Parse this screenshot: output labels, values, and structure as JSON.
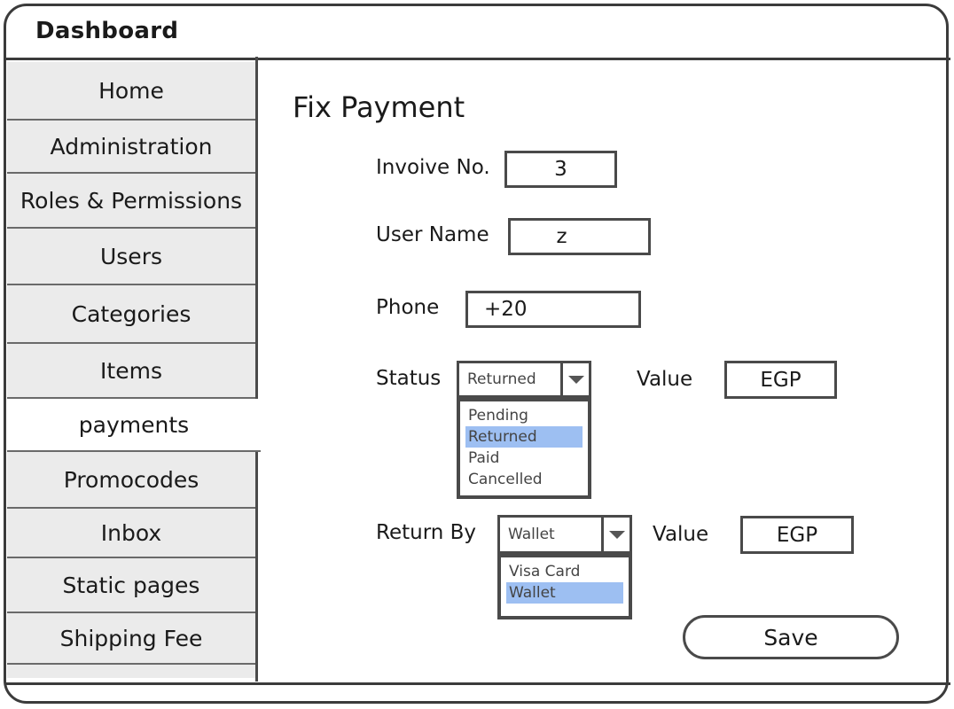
{
  "app": {
    "title": "Dashboard"
  },
  "sidebar": {
    "items": [
      {
        "label": "Home"
      },
      {
        "label": "Administration"
      },
      {
        "label": "Roles & Permissions"
      },
      {
        "label": "Users"
      },
      {
        "label": "Categories"
      },
      {
        "label": "Items"
      },
      {
        "label": "payments"
      },
      {
        "label": "Promocodes"
      },
      {
        "label": "Inbox"
      },
      {
        "label": "Static pages"
      },
      {
        "label": "Shipping Fee"
      }
    ],
    "active": "payments"
  },
  "page": {
    "title": "Fix Payment"
  },
  "form": {
    "invoice_label": "Invoive No.",
    "invoice_value": "3",
    "username_label": "User Name",
    "username_value": "z",
    "phone_label": "Phone",
    "phone_value": "+20",
    "status_label": "Status",
    "status_selected": "Returned",
    "status_options": [
      "Pending",
      "Returned",
      "Paid",
      "Cancelled"
    ],
    "status_value_label": "Value",
    "status_value_value": "EGP",
    "returnby_label": "Return By",
    "returnby_selected": "Wallet",
    "returnby_options": [
      "Visa Card",
      "Wallet"
    ],
    "returnby_value_label": "Value",
    "returnby_value_value": "EGP",
    "save_label": "Save"
  },
  "colors": {
    "selected_option": "#9dbff2",
    "sidebar_bg": "#ebebeb",
    "border": "#4a4a4a"
  }
}
